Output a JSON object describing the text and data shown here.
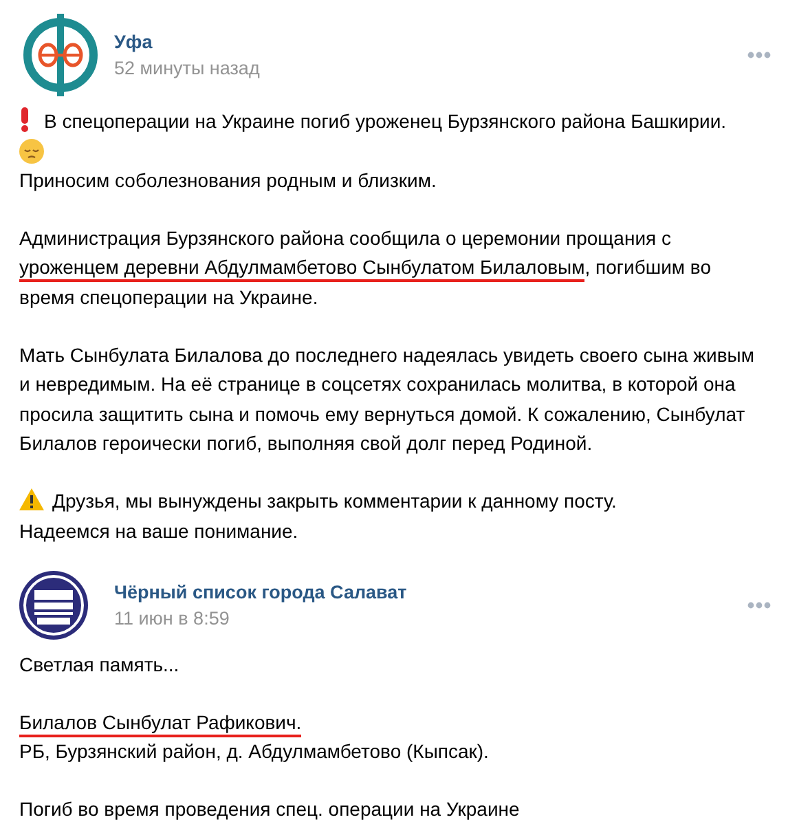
{
  "post": {
    "author": "Уфа",
    "time": "52 минуты назад",
    "paragraphs": [
      {
        "lines": [
          [
            {
              "kind": "exclamation"
            },
            {
              "text": "В спецоперации на Украине погиб уроженец Бурзянского района Башкирии."
            }
          ],
          [
            {
              "kind": "sad"
            }
          ],
          [
            {
              "text": "Приносим соболезнования родным и близким."
            }
          ]
        ]
      },
      {
        "lines": [
          [
            {
              "text": "Администрация Бурзянского района сообщила о церемонии прощания с"
            }
          ],
          [
            {
              "text": "уроженцем деревни Абдулмамбетово Сынбулатом Билаловым",
              "marked": true
            },
            {
              "text": ", погибшим во"
            }
          ],
          [
            {
              "text": "время спецоперации на Украине."
            }
          ]
        ]
      },
      {
        "lines": [
          [
            {
              "text": "Мать Сынбулата Билалова до последнего надеялась увидеть своего сына живым"
            }
          ],
          [
            {
              "text": "и невредимым. На её странице в соцсетях сохранилась молитва, в которой она"
            }
          ],
          [
            {
              "text": "просила защитить сына и помочь ему вернуться домой. К сожалению, Сынбулат"
            }
          ],
          [
            {
              "text": "Билалов героически погиб, выполняя свой долг перед Родиной."
            }
          ]
        ]
      },
      {
        "lines": [
          [
            {
              "kind": "warning"
            },
            {
              "text": "Друзья, мы вынуждены закрыть комментарии к данному посту."
            }
          ],
          [
            {
              "text": "Надеемся на ваше понимание."
            }
          ]
        ]
      }
    ],
    "repost": {
      "author": "Чёрный список города Салават",
      "time": "11 июн в 8:59",
      "paragraphs": [
        {
          "lines": [
            [
              {
                "text": "Светлая память..."
              }
            ]
          ]
        },
        {
          "lines": [
            [
              {
                "text": "Билалов Сынбулат Рафикович.",
                "marked": true
              }
            ],
            [
              {
                "text": "РБ, Бурзянский район, д. Абдулмамбетово (Кыпсак)."
              }
            ]
          ]
        },
        {
          "lines": [
            [
              {
                "text": "Погиб во время проведения спец. операции на Украине"
              }
            ]
          ]
        }
      ]
    }
  }
}
